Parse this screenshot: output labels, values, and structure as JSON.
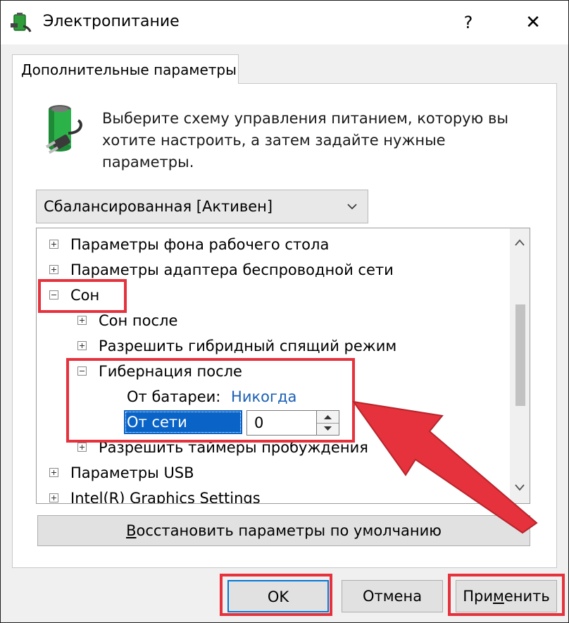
{
  "window": {
    "title": "Электропитание",
    "help_label": "?",
    "close_label": "✕"
  },
  "tab": {
    "label": "Дополнительные параметры"
  },
  "description": {
    "line1": "Выберите схему управления питанием, которую вы",
    "line2": "хотите настроить, а затем задайте нужные параметры."
  },
  "scheme_select": {
    "value": "Сбалансированная [Активен]"
  },
  "tree": {
    "items": [
      {
        "label": "Параметры фона рабочего стола",
        "expander": "plus"
      },
      {
        "label": "Параметры адаптера беспроводной сети",
        "expander": "plus"
      },
      {
        "label": "Сон",
        "expander": "minus"
      },
      {
        "label": "Сон после",
        "expander": "plus"
      },
      {
        "label": "Разрешить гибридный спящий режим",
        "expander": "plus"
      },
      {
        "label": "Гибернация после",
        "expander": "minus"
      },
      {
        "label": "От батареи:",
        "value": "Никогда"
      },
      {
        "label": "От сети (мин.):",
        "value": "0"
      },
      {
        "label": "Разрешить таймеры пробуждения",
        "expander": "plus"
      },
      {
        "label": "Параметры USB",
        "expander": "plus"
      },
      {
        "label": "Intel(R) Graphics Settings",
        "expander": "plus"
      }
    ]
  },
  "buttons": {
    "restore_prefix": "В",
    "restore_rest": "осстановить параметры по умолчанию",
    "ok": "OK",
    "cancel": "Отмена",
    "apply_prefix": "При",
    "apply_underlined": "м",
    "apply_suffix": "енить"
  },
  "colors": {
    "highlight": "#e5323c",
    "selection": "#0a64c8",
    "link": "#1a5fb4",
    "accent_button_border": "#0078d7"
  },
  "icons": {
    "app": "power-options-icon",
    "battery": "battery-plug-icon"
  }
}
